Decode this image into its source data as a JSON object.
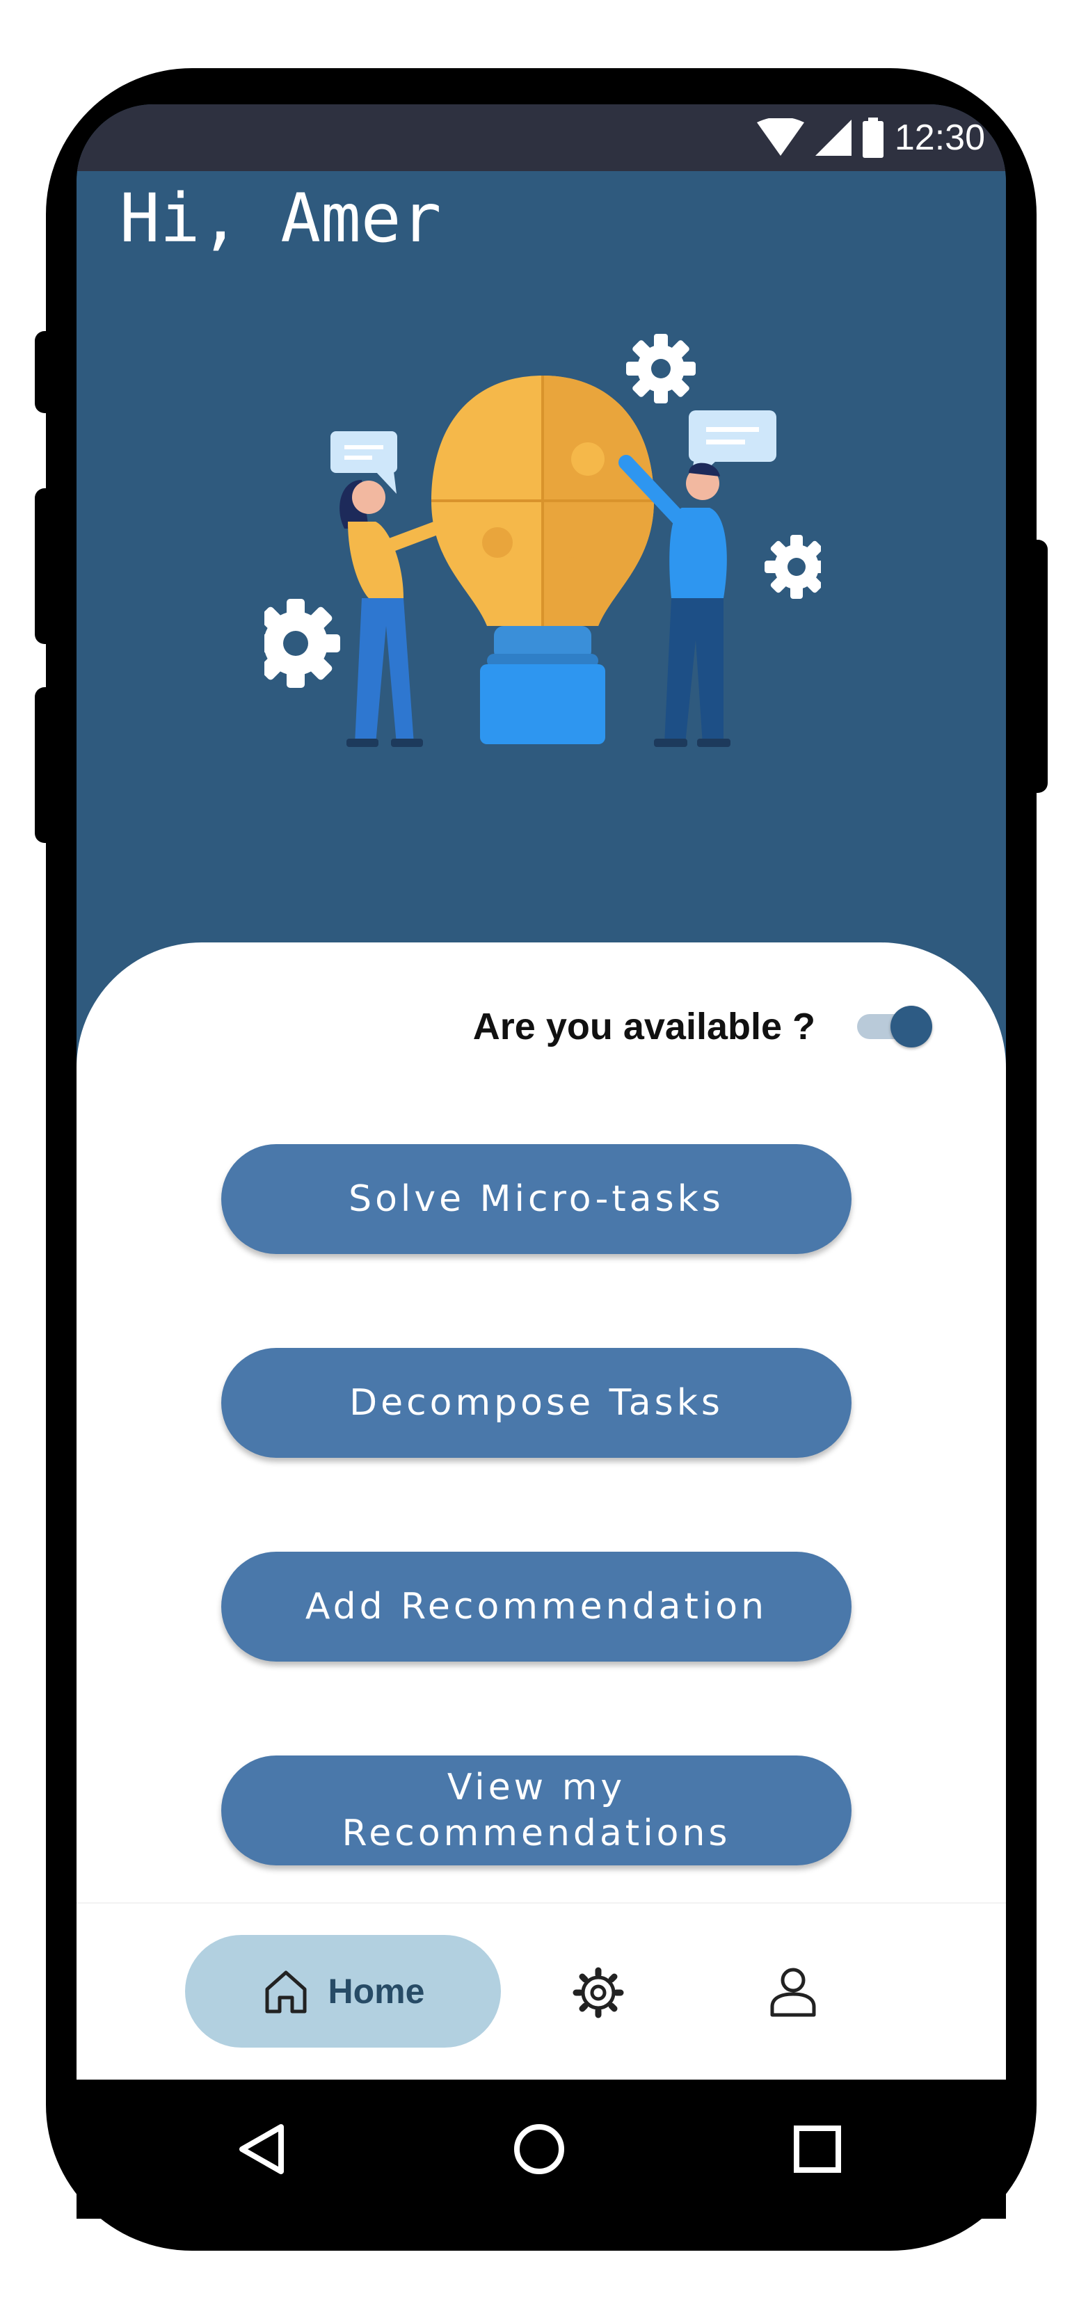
{
  "status_bar": {
    "time": "12:30"
  },
  "header": {
    "greeting": "Hi, Amer"
  },
  "availability": {
    "label": "Are you available ?",
    "enabled": true
  },
  "actions": [
    {
      "label": "Solve Micro-tasks"
    },
    {
      "label": "Decompose Tasks"
    },
    {
      "label": "Add Recommendation"
    },
    {
      "label": "View my Recommendations"
    }
  ],
  "bottom_nav": {
    "items": [
      {
        "label": "Home",
        "icon": "home-icon",
        "active": true
      },
      {
        "label": "",
        "icon": "settings-gear-icon",
        "active": false
      },
      {
        "label": "",
        "icon": "profile-icon",
        "active": false
      }
    ]
  },
  "system_nav": {
    "icons": [
      "back-icon",
      "home-circle-icon",
      "recents-icon"
    ]
  },
  "colors": {
    "header_bg": "#2f5a7e",
    "button_bg": "#4a78aa",
    "nav_active_bg": "#b2d0e0",
    "toggle_thumb": "#2d5b84",
    "status_bar": "#2e3140"
  }
}
